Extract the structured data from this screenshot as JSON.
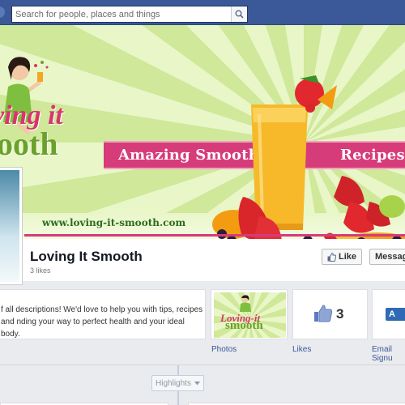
{
  "topbar": {
    "search": {
      "placeholder": "Search for people, places and things"
    }
  },
  "cover": {
    "brand_line1": "ving it",
    "brand_line2": "ooth",
    "ribbon_left": "Amazing Smoothie",
    "ribbon_right": "Recipes",
    "website": "www.loving-it-smooth.com"
  },
  "page": {
    "name": "Loving It Smooth",
    "likes": "3 likes",
    "like_button": "Like",
    "message_button": "Messag"
  },
  "about": {
    "text": "f all descriptions! We'd love to help you with tips, recipes and nding your way to perfect health and your ideal body."
  },
  "tiles": {
    "photos": {
      "label": "Photos",
      "thumb_line1": "Loving-it",
      "thumb_line2": "smooth"
    },
    "likes": {
      "label": "Likes",
      "count": "3"
    },
    "email": {
      "label": "Email Signu",
      "icon_text": "A"
    }
  },
  "timeline": {
    "highlights": "Highlights"
  },
  "colors": {
    "facebook_blue": "#3b5998",
    "brand_pink": "#d63b7a",
    "brand_green": "#6aa12b"
  }
}
